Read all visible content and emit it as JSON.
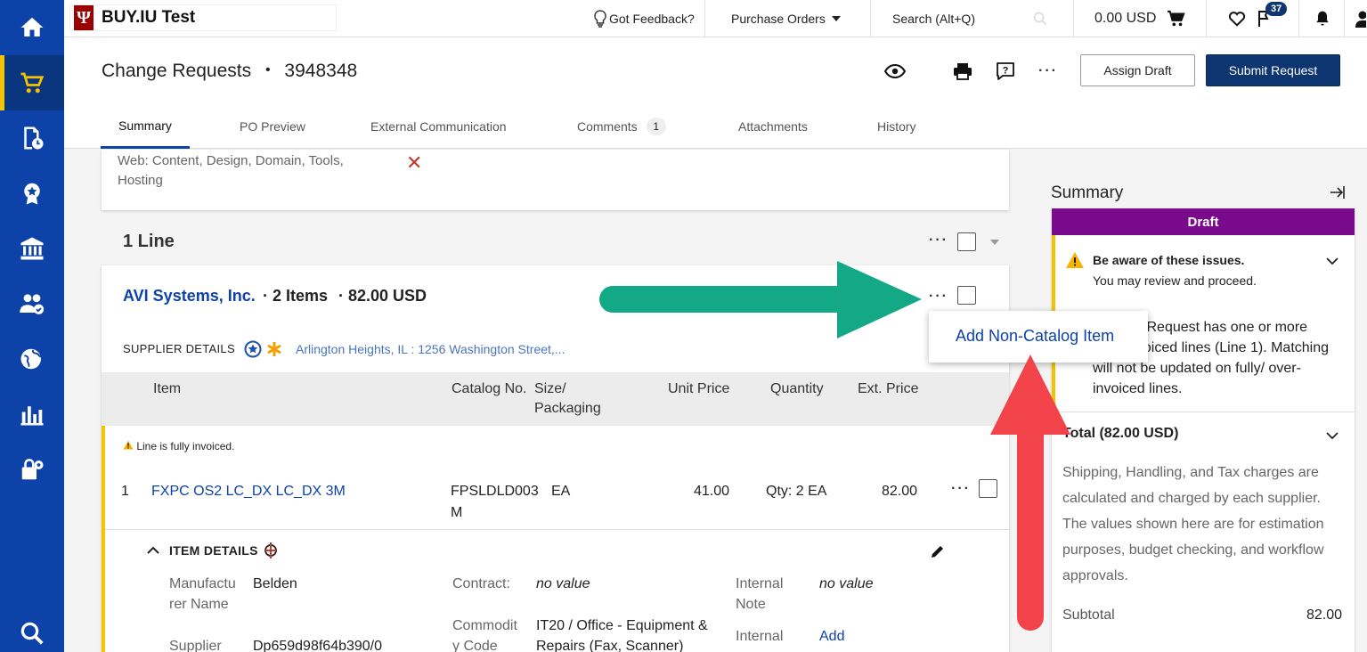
{
  "brand": {
    "logo_text": "Ψ",
    "title": "BUY.IU Test"
  },
  "topbar": {
    "feedback": "Got Feedback?",
    "purchase_orders": "Purchase Orders",
    "search": "Search (Alt+Q)",
    "cart_total": "0.00 USD",
    "flag_count": "37"
  },
  "header": {
    "title": "Change Requests",
    "separator": "•",
    "number": "3948348",
    "assign_draft": "Assign Draft",
    "submit_request": "Submit Request",
    "more": "···"
  },
  "tabs": [
    {
      "label": "Summary"
    },
    {
      "label": "PO Preview"
    },
    {
      "label": "External Communication"
    },
    {
      "label": "Comments",
      "count": "1"
    },
    {
      "label": "Attachments"
    },
    {
      "label": "History"
    }
  ],
  "top_card": {
    "text": "Web: Content, Design, Domain, Tools, Hosting",
    "remove": "✕"
  },
  "lines": {
    "heading": "1 Line",
    "more": "···"
  },
  "supplier": {
    "name": "AVI Systems, Inc.",
    "items": "· 2 Items",
    "amount": "· 82.00 USD",
    "more": "···",
    "details_label": "SUPPLIER DETAILS",
    "address": "Arlington Heights, IL : 1256 Washington Street,..."
  },
  "menu": {
    "add_non_catalog": "Add Non-Catalog Item"
  },
  "table": {
    "headers": {
      "item": "Item",
      "catalog": "Catalog No.",
      "size_1": "Size/",
      "size_2": "Packaging",
      "unit_price": "Unit Price",
      "quantity": "Quantity",
      "ext_price": "Ext. Price"
    },
    "line_note": "Line is fully invoiced.",
    "row": {
      "num": "1",
      "item": "FXPC OS2 LC_DX LC_DX 3M",
      "catalog_1": "FPSLDLD003",
      "catalog_2": "M",
      "size": "EA",
      "unit_price": "41.00",
      "quantity": "Qty: 2 EA",
      "ext_price": "82.00",
      "more": "···"
    }
  },
  "item_details": {
    "label": "ITEM DETAILS",
    "manufacturer_label_1": "Manufactu",
    "manufacturer_label_2": "rer Name",
    "manufacturer_value": "Belden",
    "supplier_label": "Supplier",
    "supplier_value": "Dp659d98f64b390/0",
    "contract_label": "Contract:",
    "contract_value": "no value",
    "commodity_label_1": "Commodit",
    "commodity_label_2": "y Code",
    "commodity_value_1": "IT20 / Office - Equipment &",
    "commodity_value_2": "Repairs (Fax, Scanner)",
    "internal_note_label_1": "Internal",
    "internal_note_label_2": "Note",
    "internal_note_value": "no value",
    "internal_label_2": "Internal",
    "internal_add": "Add"
  },
  "summary": {
    "title": "Summary",
    "status": "Draft",
    "issue_title": "Be aware of these issues.",
    "issue_sub": "You may review and proceed.",
    "issue_body": "Change Request has one or more over-invoiced lines (Line 1). Matching will not be updated on fully/ over-invoiced lines.",
    "total_title": "Total (82.00 USD)",
    "total_body": "Shipping, Handling, and Tax charges are calculated and charged by each supplier. The values shown here are for estimation purposes, budget checking, and workflow approvals.",
    "subtotal_label": "Subtotal",
    "subtotal_value": "82.00"
  },
  "colors": {
    "nav": "#0d43a8",
    "accent_yellow": "#f5c400",
    "draft_purple": "#7a0a8c",
    "primary_button": "#0d3570",
    "green_arrow": "#13a987",
    "red_arrow": "#f2424a"
  }
}
